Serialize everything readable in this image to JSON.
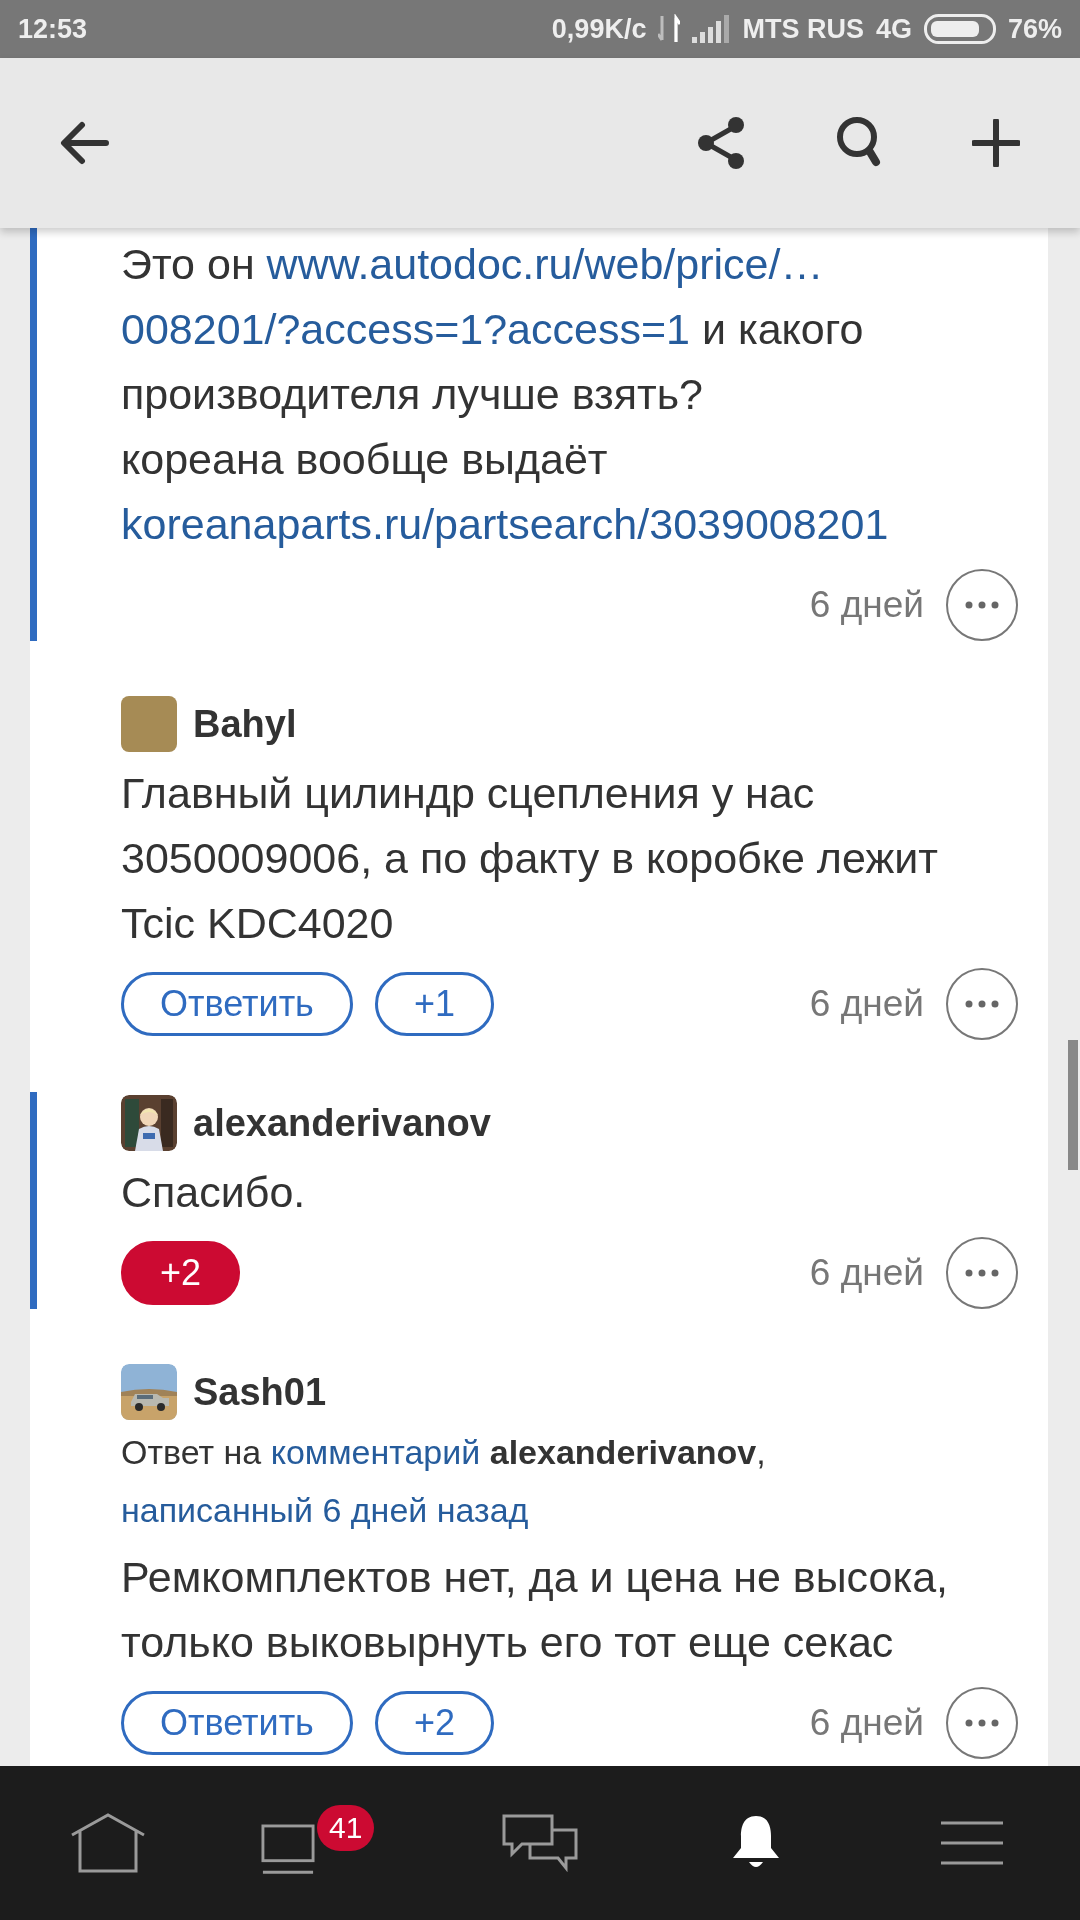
{
  "status_bar": {
    "time": "12:53",
    "speed": "0,99K/c",
    "carrier": "MTS RUS",
    "network": "4G",
    "battery": "76%"
  },
  "comments": [
    {
      "highlighted": true,
      "body": [
        [
          {
            "kind": "text",
            "text": "Это он "
          },
          {
            "kind": "link",
            "text": "www.autodoc.ru/web/price/…"
          }
        ],
        [
          {
            "kind": "link",
            "text": "008201/?access=1?access=1"
          },
          {
            "kind": "text",
            "text": " и какого"
          }
        ],
        [
          {
            "kind": "text",
            "text": "производителя лучше взять?"
          }
        ],
        [
          {
            "kind": "text",
            "text": "кореана вообще выдаёт"
          }
        ],
        [
          {
            "kind": "link",
            "text": "koreanaparts.ru/partsearch/3039008201"
          }
        ]
      ],
      "time": "6 дней"
    },
    {
      "highlighted": false,
      "avatar": {
        "kind": "plain"
      },
      "author": "Bahyl",
      "body": [
        [
          {
            "kind": "text",
            "text": "Главный цилиндр сцепления у нас"
          }
        ],
        [
          {
            "kind": "text",
            "text": "3050009006, а по факту в коробке лежит"
          }
        ],
        [
          {
            "kind": "text",
            "text": "Tcic KDC4020"
          }
        ]
      ],
      "reply_button": "Ответить",
      "vote": {
        "label": "+1",
        "active": false
      },
      "time": "6 дней"
    },
    {
      "highlighted": true,
      "avatar": {
        "kind": "figure"
      },
      "author": "alexanderivanov",
      "body": [
        [
          {
            "kind": "text",
            "text": "Спасибо."
          }
        ]
      ],
      "vote": {
        "label": "+2",
        "active": true
      },
      "time": "6 дней"
    },
    {
      "highlighted": false,
      "avatar": {
        "kind": "car"
      },
      "author": "Sash01",
      "reply_to": [
        [
          {
            "kind": "text",
            "text": "Ответ на "
          },
          {
            "kind": "link",
            "text": "комментарий"
          },
          {
            "kind": "bold",
            "text": "alexanderivanov"
          },
          {
            "kind": "text",
            "text": ","
          }
        ],
        [
          {
            "kind": "link",
            "text": "написанный 6 дней назад"
          }
        ]
      ],
      "body": [
        [
          {
            "kind": "text",
            "text": "Ремкомплектов нет, да и цена не высока,"
          }
        ],
        [
          {
            "kind": "text",
            "text": "только выковырнуть его тот еще секас"
          }
        ]
      ],
      "reply_button": "Ответить",
      "vote": {
        "label": "+2",
        "active": false
      },
      "time": "6 дней"
    }
  ],
  "bottom_nav": [
    {
      "kind": "home",
      "selected": false
    },
    {
      "kind": "feed",
      "selected": false,
      "badge": "41"
    },
    {
      "kind": "chat",
      "selected": false
    },
    {
      "kind": "bell",
      "selected": true
    },
    {
      "kind": "menu",
      "selected": false
    }
  ]
}
